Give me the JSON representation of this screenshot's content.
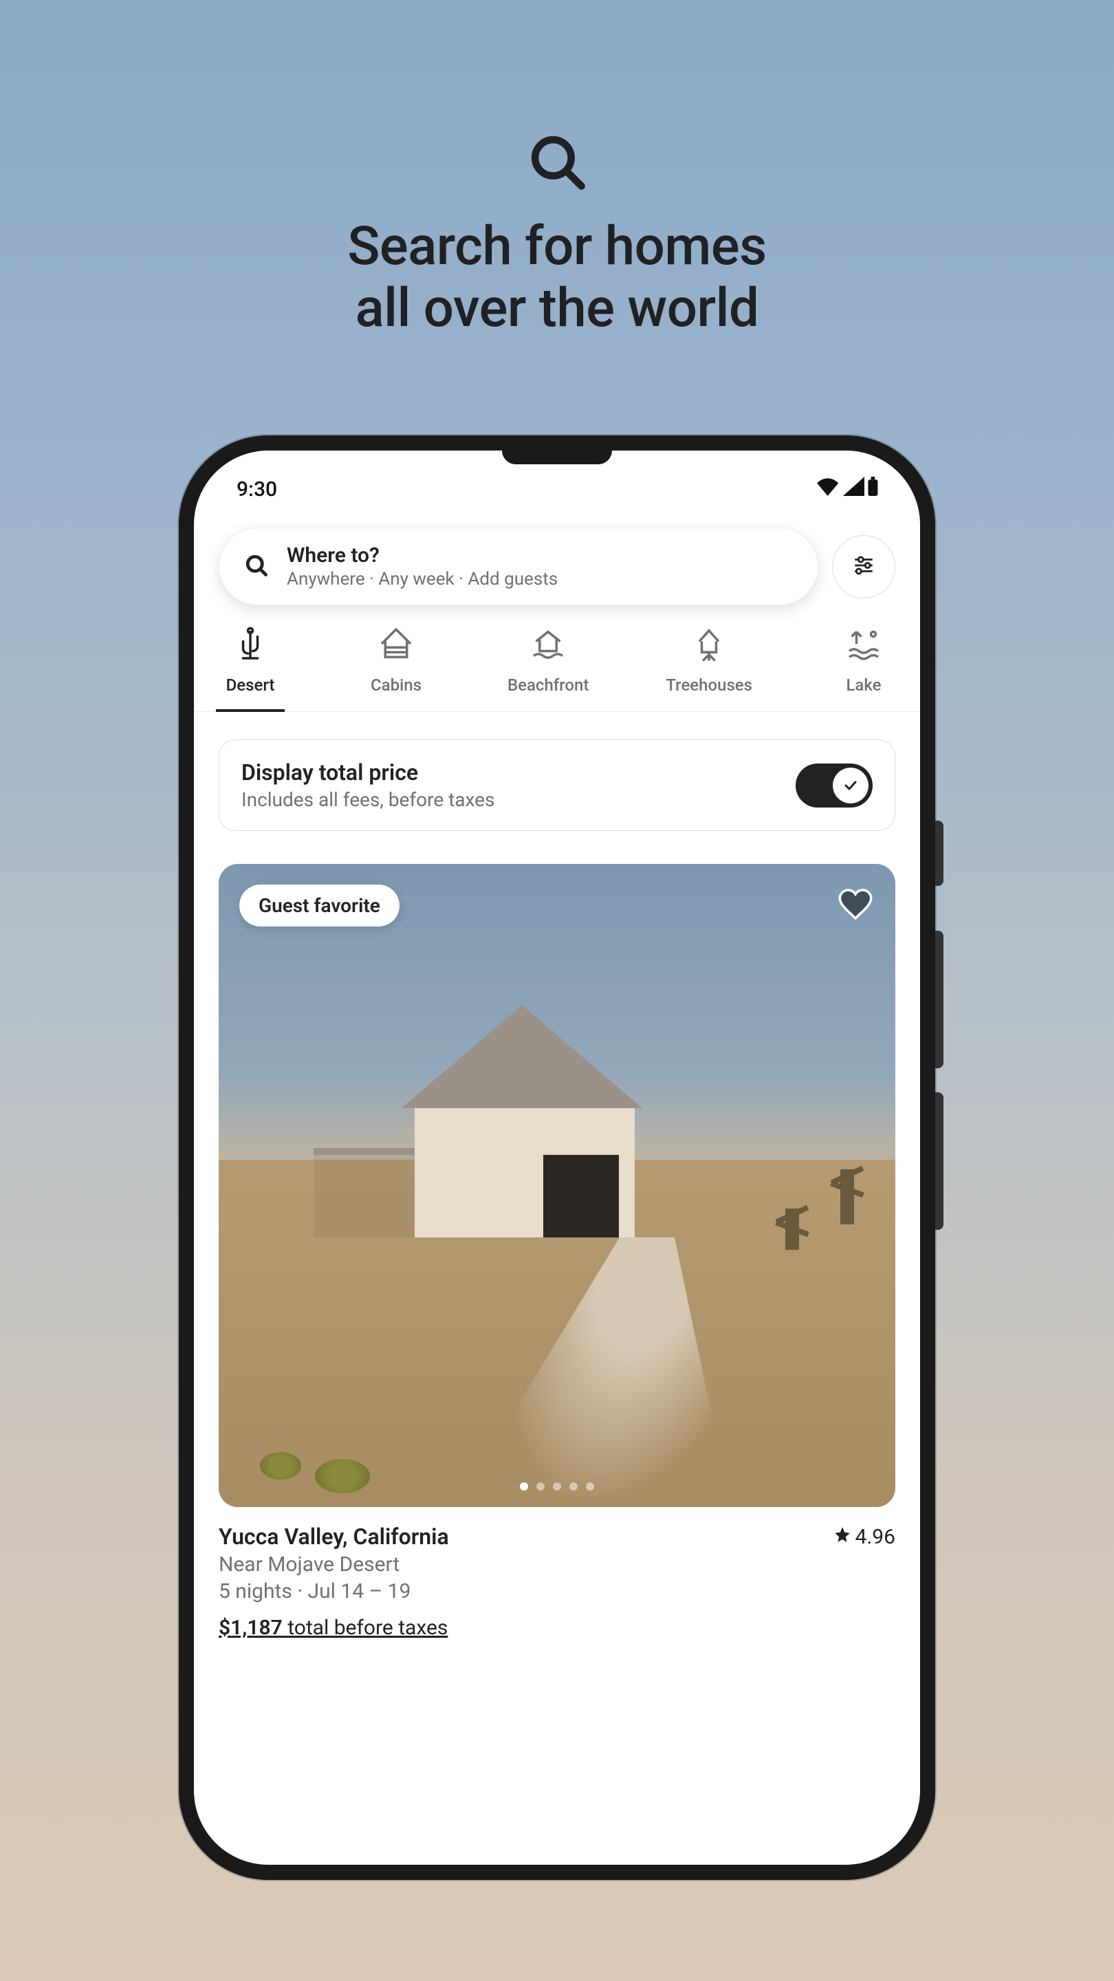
{
  "promo": {
    "line1": "Search for homes",
    "line2": "all over the world"
  },
  "status": {
    "time": "9:30"
  },
  "search": {
    "title": "Where to?",
    "subtitle": "Anywhere · Any week · Add guests"
  },
  "categories": [
    {
      "label": "Desert",
      "active": true
    },
    {
      "label": "Cabins",
      "active": false
    },
    {
      "label": "Beachfront",
      "active": false
    },
    {
      "label": "Treehouses",
      "active": false
    },
    {
      "label": "Lake",
      "active": false
    }
  ],
  "priceToggle": {
    "title": "Display total price",
    "subtitle": "Includes all fees, before taxes",
    "enabled": true
  },
  "listing": {
    "badge": "Guest favorite",
    "title": "Yucca Valley, California",
    "rating": "4.96",
    "subtitle1": "Near Mojave Desert",
    "subtitle2": "5 nights · Jul 14 – 19",
    "price": "$1,187",
    "priceSuffix": " total before taxes"
  }
}
